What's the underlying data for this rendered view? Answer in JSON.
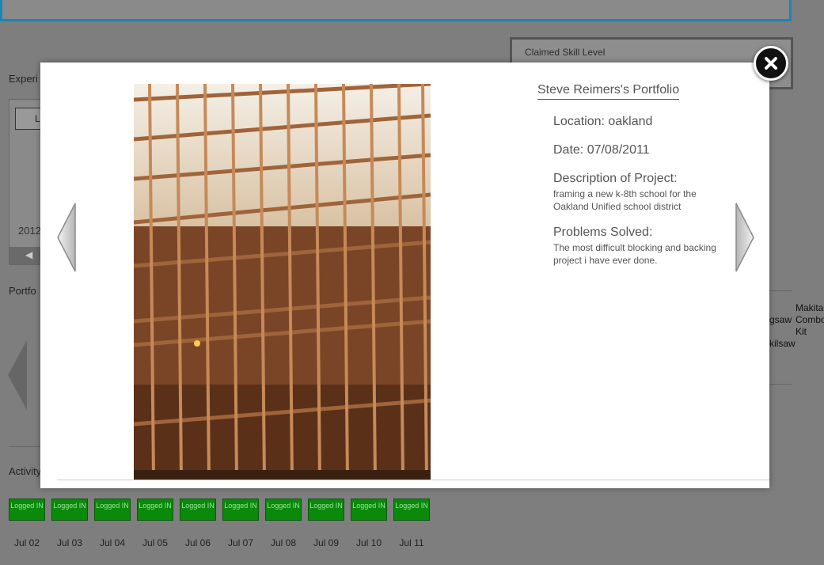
{
  "background": {
    "skill_label": "Claimed Skill Level",
    "experience_label": "Experi",
    "experience_button": "L",
    "year_label": "2012",
    "portfolio_label": "Portfo",
    "activity_label": "Activity",
    "tools": [
      {
        "text": "Makita Combo Kit"
      },
      {
        "text": "gsaw"
      },
      {
        "text": "kilsaw"
      }
    ]
  },
  "activity": {
    "badges": [
      {
        "status": "Logged IN",
        "date": "Jul 02"
      },
      {
        "status": "Logged IN",
        "date": "Jul 03"
      },
      {
        "status": "Logged IN",
        "date": "Jul 04"
      },
      {
        "status": "Logged IN",
        "date": "Jul 05"
      },
      {
        "status": "Logged IN",
        "date": "Jul 06"
      },
      {
        "status": "Logged IN",
        "date": "Jul 07"
      },
      {
        "status": "Logged IN",
        "date": "Jul 08"
      },
      {
        "status": "Logged IN",
        "date": "Jul 09"
      },
      {
        "status": "Logged IN",
        "date": "Jul 10"
      },
      {
        "status": "Logged IN",
        "date": "Jul 11"
      }
    ]
  },
  "modal": {
    "portfolio_title": "Steve Reimers's Portfolio",
    "location": "Location: oakland",
    "date": "Date: 07/08/2011",
    "description_heading": "Description of Project:",
    "description_text": "framing a new k-8th school for the Oakland Unified school district",
    "problems_heading": "Problems Solved:",
    "problems_text": "The most difficult blocking and backing project i have ever done.",
    "icons": {
      "close": "close-icon",
      "prev": "arrow-left-icon",
      "next": "arrow-right-icon"
    }
  }
}
